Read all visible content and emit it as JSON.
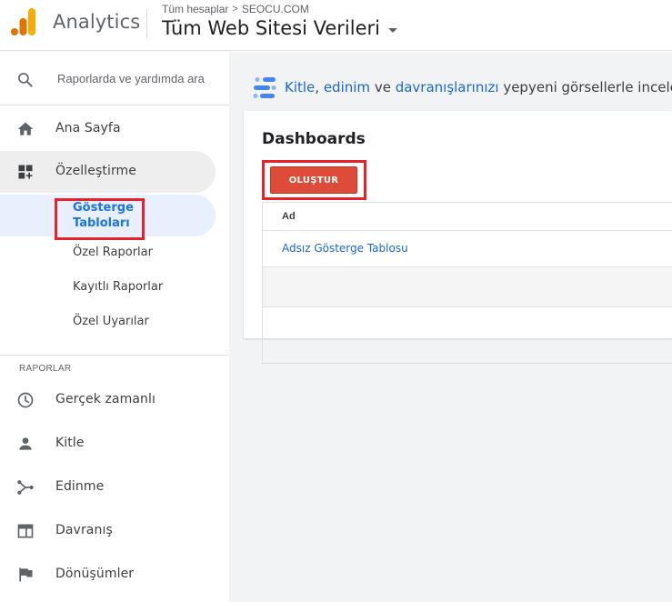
{
  "header": {
    "app_name": "Analytics",
    "breadcrumb": {
      "root": "Tüm hesaplar",
      "separator": ">",
      "account": "SEOCU.COM"
    },
    "view_name": "Tüm Web Sitesi Verileri"
  },
  "sidebar": {
    "search_label": "Raporlarda ve yardımda ara",
    "home_label": "Ana Sayfa",
    "customization_label": "Özelleştirme",
    "customization_items": [
      {
        "label": "Gösterge Tabloları",
        "selected": true
      },
      {
        "label": "Özel Raporlar"
      },
      {
        "label": "Kayıtlı Raporlar"
      },
      {
        "label": "Özel Uyarılar"
      }
    ],
    "reports_section_label": "RAPORLAR",
    "reports_items": [
      {
        "label": "Gerçek zamanlı",
        "icon": "clock-icon"
      },
      {
        "label": "Kitle",
        "icon": "person-icon"
      },
      {
        "label": "Edinme",
        "icon": "acquisition-icon"
      },
      {
        "label": "Davranış",
        "icon": "behavior-icon"
      },
      {
        "label": "Dönüşümler",
        "icon": "flag-icon"
      }
    ]
  },
  "banner": {
    "link1": "Kitle",
    "sep1": ", ",
    "link2": "edinim",
    "sep2": " ve ",
    "link3": "davranışlarınızı",
    "text_end": " yepyeni görsellerle inceleyin."
  },
  "dashboards": {
    "title": "Dashboards",
    "create_button": "OLUŞTUR",
    "column_name": "Ad",
    "rows": [
      "Adsız Gösterge Tablosu"
    ]
  },
  "colors": {
    "brand_orange": "#f9ab00",
    "brand_dark_orange": "#e37400",
    "link_blue": "#1967d2",
    "create_red": "#dd4b39",
    "highlight_red": "#e5232b",
    "selected_bg": "#e8f0fe"
  }
}
